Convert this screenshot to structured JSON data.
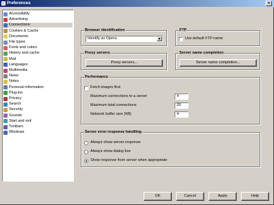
{
  "window": {
    "title": "Preferences",
    "close_glyph": "×"
  },
  "sidebar": {
    "items": [
      {
        "label": "Accessibility",
        "icon": "accessibility-icon",
        "color": "#6a8ad0"
      },
      {
        "label": "Advertising",
        "icon": "advertising-icon",
        "color": "#d04040"
      },
      {
        "label": "Connections",
        "icon": "connections-icon",
        "color": "#3a70c0",
        "selected": true
      },
      {
        "label": "Cookies & Cache",
        "icon": "cookies-icon",
        "color": "#c09040"
      },
      {
        "label": "Documents",
        "icon": "documents-icon",
        "color": "#e0d060"
      },
      {
        "label": "File types",
        "icon": "file-types-icon",
        "color": "#7090c0"
      },
      {
        "label": "Fonts and colors",
        "icon": "fonts-icon",
        "color": "#d06060"
      },
      {
        "label": "History and cache",
        "icon": "history-icon",
        "color": "#60a060"
      },
      {
        "label": "Mail",
        "icon": "mail-icon",
        "color": "#c0c040"
      },
      {
        "label": "Languages",
        "icon": "languages-icon",
        "color": "#4060c0"
      },
      {
        "label": "Multimedia",
        "icon": "multimedia-icon",
        "color": "#c04080"
      },
      {
        "label": "News",
        "icon": "news-icon",
        "color": "#808080"
      },
      {
        "label": "Notes",
        "icon": "notes-icon",
        "color": "#e0c040"
      },
      {
        "label": "Personal information",
        "icon": "personal-info-icon",
        "color": "#6080a0"
      },
      {
        "label": "Plug-ins",
        "icon": "plugins-icon",
        "color": "#40a040"
      },
      {
        "label": "Privacy",
        "icon": "privacy-icon",
        "color": "#a04040"
      },
      {
        "label": "Search",
        "icon": "search-icon",
        "color": "#4080c0"
      },
      {
        "label": "Security",
        "icon": "security-icon",
        "color": "#c0a040"
      },
      {
        "label": "Sounds",
        "icon": "sounds-icon",
        "color": "#a060c0"
      },
      {
        "label": "Start and exit",
        "icon": "start-exit-icon",
        "color": "#40a0a0"
      },
      {
        "label": "Toolbars",
        "icon": "toolbars-icon",
        "color": "#6060a0"
      },
      {
        "label": "Windows",
        "icon": "windows-icon",
        "color": "#4070b0"
      }
    ]
  },
  "browser_identification": {
    "label": "Browser identification",
    "selected": "Identify as Opera",
    "arrow": "▼"
  },
  "ftp": {
    "label": "FTP",
    "checkbox_label": "Use default FTP name"
  },
  "proxy": {
    "label": "Proxy servers",
    "button": "Proxy servers..."
  },
  "name_completion": {
    "label": "Server name completion",
    "button": "Server name completion..."
  },
  "performance": {
    "label": "Performance",
    "fetch_label": "Fetch images first",
    "rows": [
      {
        "label": "Maximum connections to a server",
        "value": "4"
      },
      {
        "label": "Maximum total connections",
        "value": "20"
      },
      {
        "label": "Network buffer size (KB)",
        "value": "4"
      }
    ]
  },
  "server_error": {
    "label": "Server error response handling",
    "options": [
      {
        "label": "Always show server response",
        "checked": false
      },
      {
        "label": "Always show dialog box",
        "checked": false
      },
      {
        "label": "Show response from server when appropriate",
        "checked": true
      }
    ]
  },
  "footer": {
    "ok": "OK",
    "cancel": "Cancel",
    "apply": "Apply",
    "help": "Help"
  }
}
